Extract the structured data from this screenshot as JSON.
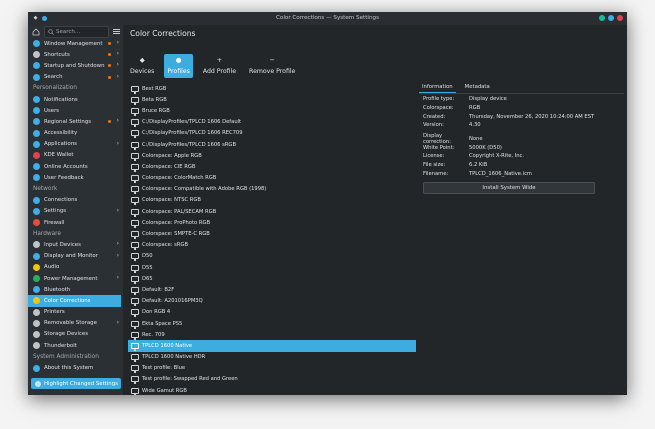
{
  "window": {
    "title": "Color Corrections — System Settings",
    "colors": {
      "accent": "#3dade0",
      "bg": "#232629",
      "sidebar": "#2b3034"
    }
  },
  "search": {
    "placeholder": "Search..."
  },
  "sidebar": {
    "items": [
      {
        "type": "item",
        "label": "Window Management",
        "icon": "window-icon",
        "color": "#3daee9",
        "dot": true,
        "arrow": true
      },
      {
        "type": "item",
        "label": "Shortcuts",
        "icon": "keyboard-icon",
        "color": "#bdc3c7",
        "dot": true,
        "arrow": true
      },
      {
        "type": "item",
        "label": "Startup and Shutdown",
        "icon": "power-icon",
        "color": "#3daee9",
        "dot": true,
        "arrow": true
      },
      {
        "type": "item",
        "label": "Search",
        "icon": "search-icon",
        "color": "#3daee9",
        "dot": true,
        "arrow": true
      },
      {
        "type": "cat",
        "label": "Personalization"
      },
      {
        "type": "item",
        "label": "Notifications",
        "icon": "bell-icon",
        "color": "#3daee9"
      },
      {
        "type": "item",
        "label": "Users",
        "icon": "users-icon",
        "color": "#3daee9"
      },
      {
        "type": "item",
        "label": "Regional Settings",
        "icon": "globe-icon",
        "color": "#3daee9",
        "dot": true,
        "arrow": true
      },
      {
        "type": "item",
        "label": "Accessibility",
        "icon": "accessibility-icon",
        "color": "#3daee9"
      },
      {
        "type": "item",
        "label": "Applications",
        "icon": "apps-icon",
        "color": "#3daee9",
        "arrow": true
      },
      {
        "type": "item",
        "label": "KDE Wallet",
        "icon": "wallet-icon",
        "color": "#da4453"
      },
      {
        "type": "item",
        "label": "Online Accounts",
        "icon": "cloud-icon",
        "color": "#3daee9"
      },
      {
        "type": "item",
        "label": "User Feedback",
        "icon": "feedback-icon",
        "color": "#3daee9"
      },
      {
        "type": "cat",
        "label": "Network"
      },
      {
        "type": "item",
        "label": "Connections",
        "icon": "network-icon",
        "color": "#3daee9"
      },
      {
        "type": "item",
        "label": "Settings",
        "icon": "settings-icon",
        "color": "#3daee9",
        "arrow": true
      },
      {
        "type": "item",
        "label": "Firewall",
        "icon": "firewall-icon",
        "color": "#e74c3c"
      },
      {
        "type": "cat",
        "label": "Hardware"
      },
      {
        "type": "item",
        "label": "Input Devices",
        "icon": "keyboard-icon",
        "color": "#bdc3c7",
        "arrow": true
      },
      {
        "type": "item",
        "label": "Display and Monitor",
        "icon": "monitor-icon",
        "color": "#3daee9",
        "arrow": true
      },
      {
        "type": "item",
        "label": "Audio",
        "icon": "speaker-icon",
        "color": "#f1c40f"
      },
      {
        "type": "item",
        "label": "Power Management",
        "icon": "battery-icon",
        "color": "#27ae60",
        "arrow": true
      },
      {
        "type": "item",
        "label": "Bluetooth",
        "icon": "bluetooth-icon",
        "color": "#3daee9"
      },
      {
        "type": "item",
        "label": "Color Corrections",
        "icon": "color-icon",
        "color": "#f1c40f",
        "selected": true
      },
      {
        "type": "item",
        "label": "Printers",
        "icon": "printer-icon",
        "color": "#bdc3c7"
      },
      {
        "type": "item",
        "label": "Removable Storage",
        "icon": "usb-icon",
        "color": "#bdc3c7",
        "arrow": true
      },
      {
        "type": "item",
        "label": "Storage Devices",
        "icon": "disk-icon",
        "color": "#bdc3c7"
      },
      {
        "type": "item",
        "label": "Thunderbolt",
        "icon": "thunderbolt-icon",
        "color": "#bdc3c7"
      },
      {
        "type": "cat",
        "label": "System Administration"
      },
      {
        "type": "item",
        "label": "About this System",
        "icon": "info-icon",
        "color": "#3daee9"
      }
    ],
    "highlight_label": "Highlight Changed Settings"
  },
  "main": {
    "title": "Color Corrections",
    "toolbar": [
      {
        "label": "Devices",
        "glyph": "◆",
        "active": false
      },
      {
        "label": "Profiles",
        "glyph": "●",
        "active": true
      },
      {
        "label": "Add Profile",
        "glyph": "+",
        "active": false
      },
      {
        "label": "Remove Profile",
        "glyph": "−",
        "active": false
      }
    ]
  },
  "profiles": [
    "Best RGB",
    "Beta RGB",
    "Bruce RGB",
    "C:/DisplayProfiles/TPLCD 1606 Default",
    "C:/DisplayProfiles/TPLCD 1606 REC709",
    "C:/DisplayProfiles/TPLCD 1606 sRGB",
    "Colorspace: Apple RGB",
    "Colorspace: CIE RGB",
    "Colorspace: ColorMatch RGB",
    "Colorspace: Compatible with Adobe RGB (1998)",
    "Colorspace: NTSC RGB",
    "Colorspace: PAL/SECAM RGB",
    "Colorspace: ProPhoto RGB",
    "Colorspace: SMPTE-C RGB",
    "Colorspace: sRGB",
    "D50",
    "D55",
    "D65",
    "Default: B2F",
    "Default: A201016PM3Q",
    "Don RGB 4",
    "Ekta Space PS5",
    "Rec. 709",
    "TPLCD 1600 Native",
    "TPLCD 1600 Native HDR",
    "Test profile: Blue",
    "Test profile: Swapped Red and Green",
    "Wide Gamut RGB",
    "scRGB v4"
  ],
  "selected_profile_index": 23,
  "details": {
    "tabs": [
      "Information",
      "Metadata"
    ],
    "active_tab": 0,
    "rows1": [
      {
        "k": "Profile type:",
        "v": "Display device"
      },
      {
        "k": "Colorspace:",
        "v": "RGB"
      },
      {
        "k": "Created:",
        "v": "Thursday, November 26, 2020 10:24:00 AM EST"
      },
      {
        "k": "Version:",
        "v": "4.30"
      }
    ],
    "rows2": [
      {
        "k": "Display correction:",
        "v": "None"
      },
      {
        "k": "White Point:",
        "v": "5000K (D50)"
      },
      {
        "k": "License:",
        "v": "Copyright X-Rite, Inc."
      },
      {
        "k": "File size:",
        "v": "6.2 KiB"
      },
      {
        "k": "Filename:",
        "v": "TPLCD_1606_Native.icm"
      }
    ],
    "install_label": "Install System Wide"
  }
}
